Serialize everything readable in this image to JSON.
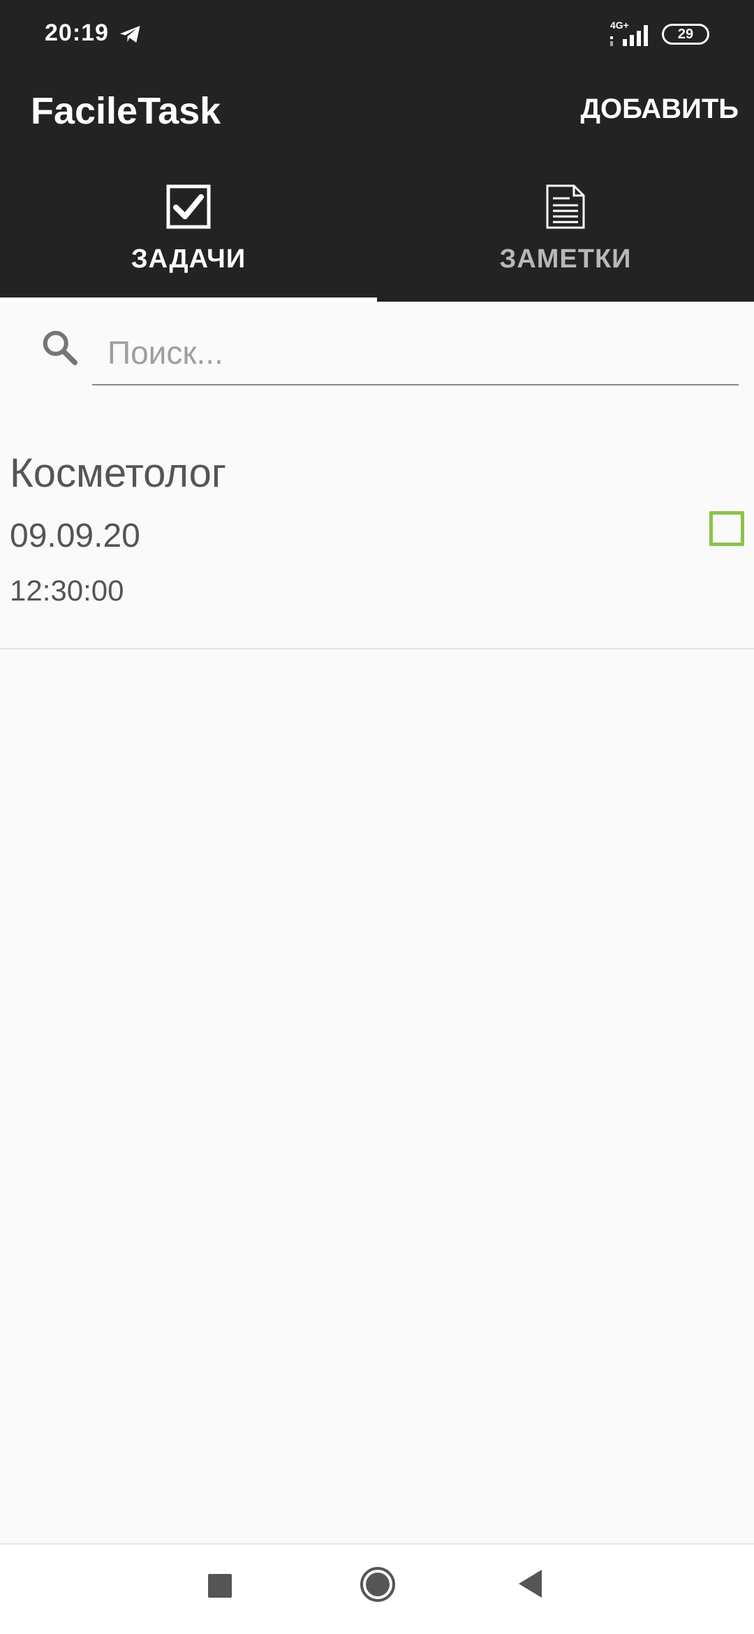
{
  "status_bar": {
    "time": "20:19",
    "network_type": "4G+",
    "battery_level": "29",
    "icons": [
      "telegram-icon",
      "signal-icon",
      "battery-icon"
    ]
  },
  "app_bar": {
    "title": "FacileTask",
    "add_label": "ДОБАВИТЬ"
  },
  "tabs": [
    {
      "label": "ЗАДАЧИ",
      "icon": "checkbox-checked-icon",
      "active": true
    },
    {
      "label": "ЗАМЕТКИ",
      "icon": "note-icon",
      "active": false
    }
  ],
  "search": {
    "placeholder": "Поиск...",
    "value": "",
    "icon": "search-icon"
  },
  "tasks": [
    {
      "title": "Косметолог",
      "date": "09.09.20",
      "time": "12:30:00",
      "checked": false
    }
  ],
  "nav_bar": {
    "icons": [
      "recents-icon",
      "home-icon",
      "back-icon"
    ]
  },
  "colors": {
    "header_bg": "#232323",
    "content_bg": "#fafafa",
    "checkbox_accent": "#8bc34a",
    "text_primary": "#555555",
    "tab_inactive": "#b8b8b8"
  }
}
